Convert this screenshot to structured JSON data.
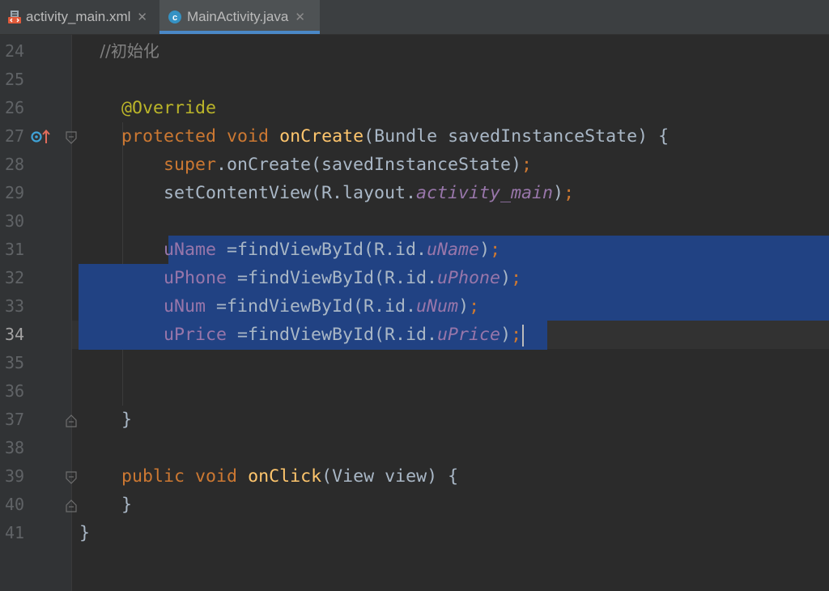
{
  "tabs": [
    {
      "label": "activity_main.xml",
      "icon": "xml-layout-icon",
      "active": false
    },
    {
      "label": "MainActivity.java",
      "icon": "java-class-icon",
      "active": true
    }
  ],
  "editor": {
    "current_line": "34",
    "lines": [
      {
        "num": "24",
        "code": "    //初始化"
      },
      {
        "num": "25",
        "code": ""
      },
      {
        "num": "26",
        "code": "    @Override"
      },
      {
        "num": "27",
        "code": "    protected void onCreate(Bundle savedInstanceState) {"
      },
      {
        "num": "28",
        "code": "        super.onCreate(savedInstanceState);"
      },
      {
        "num": "29",
        "code": "        setContentView(R.layout.activity_main);"
      },
      {
        "num": "30",
        "code": ""
      },
      {
        "num": "31",
        "code": "        uName =findViewById(R.id.uName);"
      },
      {
        "num": "32",
        "code": "        uPhone =findViewById(R.id.uPhone);"
      },
      {
        "num": "33",
        "code": "        uNum =findViewById(R.id.uNum);"
      },
      {
        "num": "34",
        "code": "        uPrice =findViewById(R.id.uPrice);"
      },
      {
        "num": "35",
        "code": ""
      },
      {
        "num": "36",
        "code": ""
      },
      {
        "num": "37",
        "code": "    }"
      },
      {
        "num": "38",
        "code": ""
      },
      {
        "num": "39",
        "code": "    public void onClick(View view) {"
      },
      {
        "num": "40",
        "code": "    }"
      },
      {
        "num": "41",
        "code": "}"
      }
    ]
  },
  "colors": {
    "background": "#2b2b2b",
    "gutter": "#313335",
    "selection": "#214283",
    "keyword": "#cc7832",
    "method": "#ffc66d",
    "annotation": "#bbb529",
    "field": "#9876aa",
    "comment": "#808080",
    "text": "#a9b7c6",
    "tab_underline": "#4a88c7"
  }
}
